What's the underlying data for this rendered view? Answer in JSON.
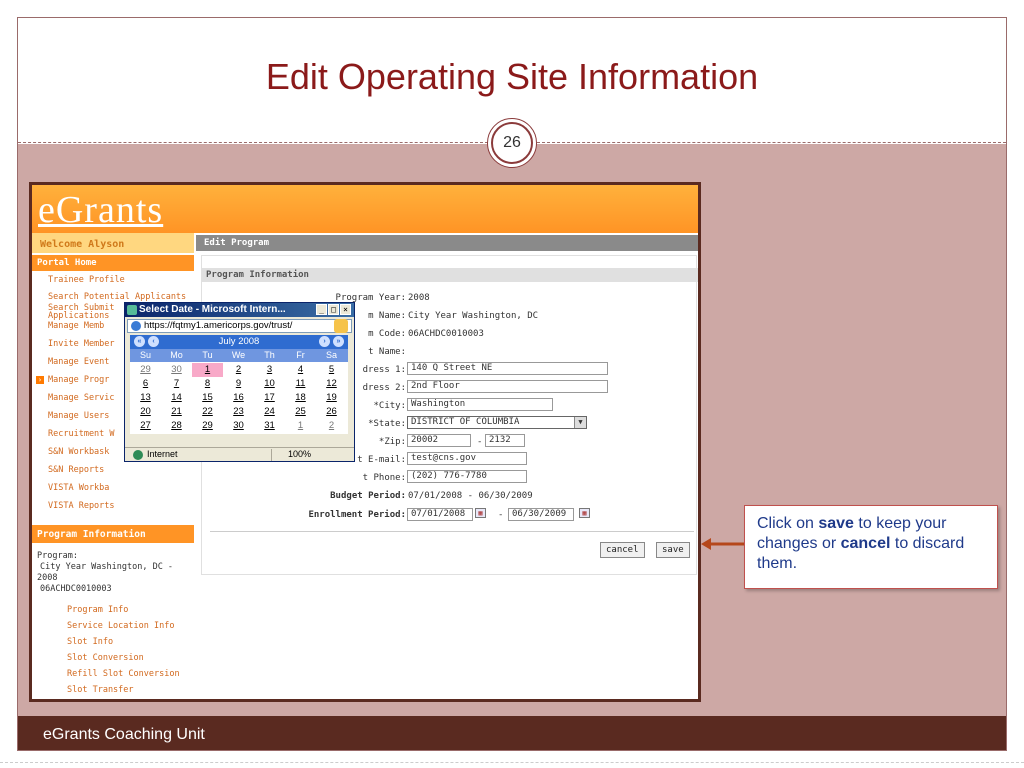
{
  "slide": {
    "title": "Edit Operating Site Information",
    "page_number": "26",
    "footer": "eGrants Coaching Unit",
    "callout": {
      "part1": "Click on ",
      "save_word": "save",
      "part2": " to keep your changes or ",
      "cancel_word": "cancel",
      "part3": " to discard them."
    },
    "colors": {
      "title": "#8b1a1a",
      "panel": "#cda8a5",
      "footer": "#5a2a20",
      "accent": "#ff9425"
    }
  },
  "app": {
    "logo": "eGrants",
    "welcome": "Welcome Alyson",
    "portal_home": "Portal Home",
    "nav_items": [
      "Trainee Profile",
      "Search Potential Applicants",
      "Search Submit",
      "Applications",
      "Manage Memb",
      "Invite Member",
      "Manage Event",
      "Manage Progr",
      "Manage Servic",
      "Manage Users",
      "Recruitment W",
      "S&N Workbask",
      "S&N Reports",
      "VISTA Workba",
      "VISTA Reports"
    ],
    "program_info_header": "Program Information",
    "program_label": "Program:",
    "program_name": "City Year Washington, DC -",
    "program_year_short": "2008",
    "program_code": "06ACHDC0010003",
    "program_links": [
      "Program Info",
      "Service Location Info",
      "Slot Info",
      "Slot Conversion",
      "Refill Slot Conversion",
      "Slot Transfer"
    ],
    "edit_program": "Edit Program",
    "section_title": "Program Information",
    "fields": {
      "program_year_label": "Program Year:",
      "program_year": "2008",
      "program_name_label": "m Name:",
      "program_name": "City Year Washington, DC",
      "program_code_label": "m Code:",
      "program_code": "06ACHDC0010003",
      "contact_label": "t Name:",
      "address1_label": "dress 1:",
      "address1": "140 Q Street NE",
      "address2_label": "dress 2:",
      "address2": "2nd Floor",
      "city_label": "*City:",
      "city": "Washington",
      "state_label": "*State:",
      "state": "DISTRICT OF COLUMBIA",
      "zip_label": "*Zip:",
      "zip": "20002",
      "zip4": "2132",
      "email_label": "t E-mail:",
      "email": "test@cns.gov",
      "phone_label": "t Phone:",
      "phone": "(202) 776-7780",
      "budget_label": "Budget Period:",
      "budget": "07/01/2008 - 06/30/2009",
      "enroll_label": "Enrollment Period:",
      "enroll_start": "07/01/2008",
      "enroll_end": "06/30/2009",
      "dash": "-"
    },
    "buttons": {
      "cancel": "cancel",
      "save": "save"
    }
  },
  "popup": {
    "title": "Select Date - Microsoft Intern...",
    "address": "https://fqtmy1.americorps.gov/trust/",
    "month": "July 2008",
    "day_headers": [
      "Su",
      "Mo",
      "Tu",
      "We",
      "Th",
      "Fr",
      "Sa"
    ],
    "weeks": [
      [
        "29",
        "30",
        "1",
        "2",
        "3",
        "4",
        "5"
      ],
      [
        "6",
        "7",
        "8",
        "9",
        "10",
        "11",
        "12"
      ],
      [
        "13",
        "14",
        "15",
        "16",
        "17",
        "18",
        "19"
      ],
      [
        "20",
        "21",
        "22",
        "23",
        "24",
        "25",
        "26"
      ],
      [
        "27",
        "28",
        "29",
        "30",
        "31",
        "1",
        "2"
      ]
    ],
    "selected_day": "1",
    "status_zone": "Internet",
    "zoom": "100%"
  }
}
